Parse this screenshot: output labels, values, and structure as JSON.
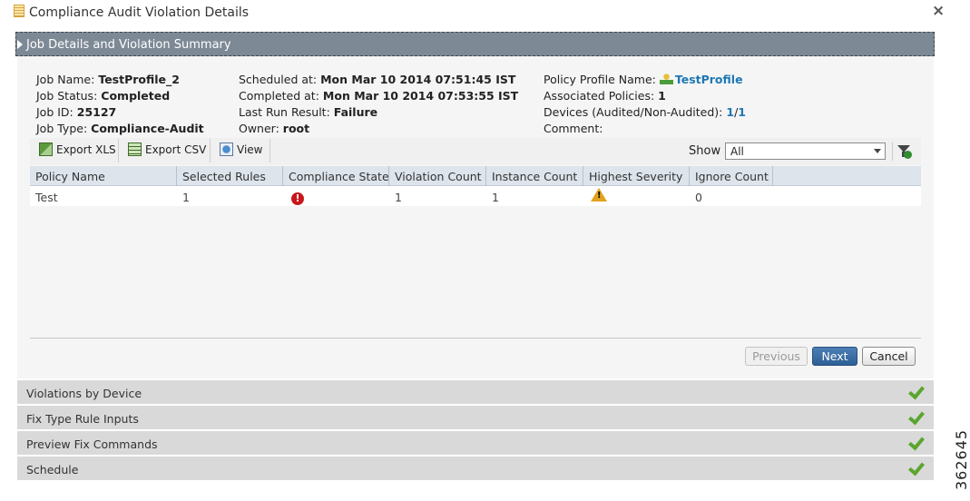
{
  "window": {
    "title": "Compliance Audit Violation Details",
    "close_glyph": "×"
  },
  "section_header": {
    "title": "Job Details and Violation Summary"
  },
  "job": {
    "name_label": "Job Name:",
    "name_value": "TestProfile_2",
    "status_label": "Job Status:",
    "status_value": "Completed",
    "id_label": "Job ID:",
    "id_value": "25127",
    "type_label": "Job Type:",
    "type_value": "Compliance-Audit",
    "scheduled_label": "Scheduled at:",
    "scheduled_value": "Mon Mar 10 2014 07:51:45 IST",
    "completed_label": "Completed at:",
    "completed_value": "Mon Mar 10 2014 07:53:55 IST",
    "last_run_label": "Last Run Result:",
    "last_run_value": "Failure",
    "owner_label": "Owner:",
    "owner_value": "root",
    "policy_profile_label": "Policy Profile Name:",
    "policy_profile_value": "TestProfile",
    "assoc_policies_label": "Associated Policies:",
    "assoc_policies_value": "1",
    "devices_label": "Devices (Audited/Non-Audited):",
    "devices_audited": "1",
    "devices_sep": "/",
    "devices_non_audited": "1",
    "comment_label": "Comment:"
  },
  "toolbar": {
    "export_xls": "Export XLS",
    "export_csv": "Export CSV",
    "view": "View",
    "show_label": "Show",
    "show_value": "All"
  },
  "table": {
    "columns": [
      "Policy Name",
      "Selected Rules",
      "Compliance State",
      "Violation Count",
      "Instance Count",
      "Highest Severity",
      "Ignore Count"
    ],
    "rows": [
      {
        "policy_name": "Test",
        "selected_rules": "1",
        "compliance_state": "error-icon",
        "violation_count": "1",
        "instance_count": "1",
        "highest_severity": "warning-icon",
        "ignore_count": "0"
      }
    ]
  },
  "buttons": {
    "previous": "Previous",
    "next": "Next",
    "cancel": "Cancel"
  },
  "steps": [
    {
      "label": "Violations by Device",
      "status": "check-icon"
    },
    {
      "label": "Fix Type Rule Inputs",
      "status": "check-icon"
    },
    {
      "label": "Preview Fix Commands",
      "status": "check-icon"
    },
    {
      "label": "Schedule",
      "status": "check-icon"
    }
  ],
  "colors": {
    "header_bar": "#7d8995",
    "link": "#1f78b4",
    "next_button": "#2e5f95",
    "check": "#5aa52e",
    "error": "#c8181d",
    "warning": "#e2a21b"
  },
  "figure_number": "362645"
}
